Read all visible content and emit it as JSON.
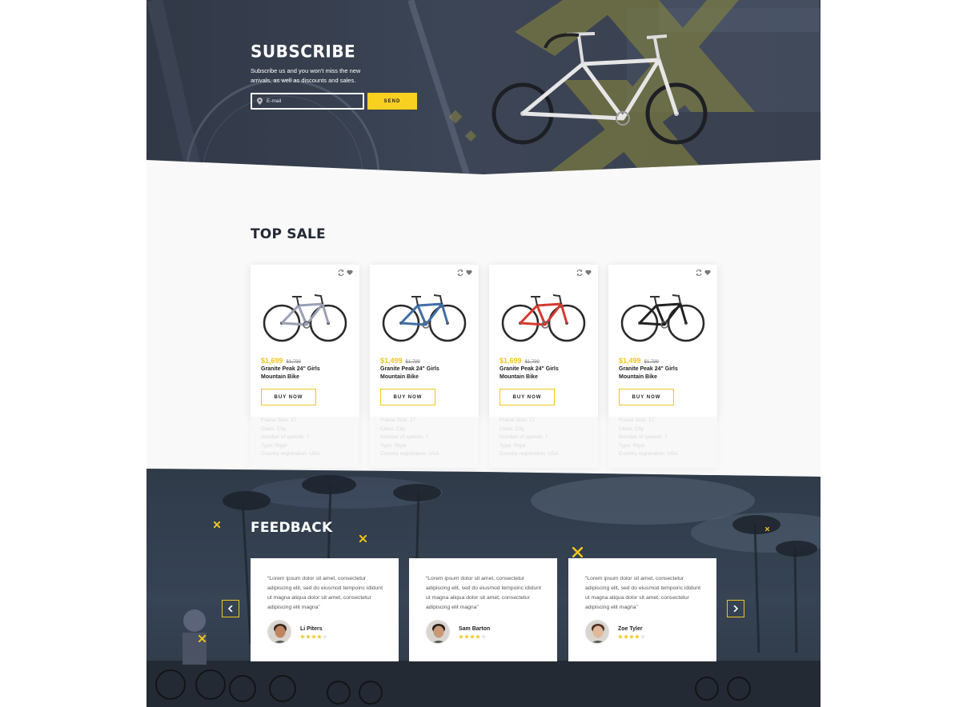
{
  "subscribe": {
    "title": "SUBSCRIBE",
    "text": "Subscribe us and you won't miss the new arrivals, as well as discounts and sales.",
    "email_placeholder": "E-mail",
    "send_label": "SEND"
  },
  "top_sale": {
    "title": "TOP SALE",
    "products": [
      {
        "price": "$1,699",
        "old_price": "$1,799",
        "name": "Granite Peak 24\" Girls Mountain Bike",
        "buy_label": "BUY NOW",
        "frame_color": "#9aa0b4",
        "specs": [
          "Frame Size: 17",
          "Class: City",
          "Number of speeds: 7",
          "Type: Rigid",
          "Country registration: USA"
        ]
      },
      {
        "price": "$1,499",
        "old_price": "$1,799",
        "name": "Granite Peak 24\" Girls Mountain Bike",
        "buy_label": "BUY NOW",
        "frame_color": "#3f6ea7",
        "specs": [
          "Frame Size: 17",
          "Class: City",
          "Number of speeds: 7",
          "Type: Rigid",
          "Country registration: USA"
        ]
      },
      {
        "price": "$1,699",
        "old_price": "$1,799",
        "name": "Granite Peak 24\" Girls Mountain Bike",
        "buy_label": "BUY NOW",
        "frame_color": "#d63a30",
        "specs": [
          "Frame Size: 17",
          "Class: City",
          "Number of speeds: 7",
          "Type: Rigid",
          "Country registration: USA"
        ]
      },
      {
        "price": "$1,499",
        "old_price": "$1,799",
        "name": "Granite Peak 24\" Girls Mountain Bike",
        "buy_label": "BUY NOW",
        "frame_color": "#222222",
        "specs": [
          "Frame Size: 17",
          "Class: City",
          "Number of speeds: 7",
          "Type: Rigid",
          "Country registration: USA"
        ]
      }
    ]
  },
  "feedback": {
    "title": "FEEDBACK",
    "reviews": [
      {
        "text": "“Lorem ipsum dolor sit amet, consectetur adipiscing elit, sed do eiusmod tempoinc ididunt ut magna aliqua dolor sit amet, consectetur adipiscing elit magna”",
        "name": "Li Piters",
        "rating": 4,
        "skin": "#c08560",
        "hair": "#3a2a20"
      },
      {
        "text": "“Lorem ipsum dolor sit amet, consectetur adipiscing elit, sed do eiusmod tempoinc ididunt ut magna aliqua dolor sit amet, consectetur adipiscing elit magna”",
        "name": "Sam Barton",
        "rating": 4,
        "skin": "#c89a78",
        "hair": "#2a1e18"
      },
      {
        "text": "“Lorem ipsum dolor sit amet, consectetur adipiscing elit, sed do eiusmod tempoinc ididunt ut magna aliqua dolor sit amet, consectetur adipiscing elit magna”",
        "name": "Zoe Tyler",
        "rating": 4,
        "skin": "#e0b89a",
        "hair": "#4a3020"
      }
    ],
    "prev_icon": "chevron-left-icon",
    "next_icon": "chevron-right-icon"
  },
  "colors": {
    "accent": "#f2c51c",
    "dark": "#232a36"
  }
}
